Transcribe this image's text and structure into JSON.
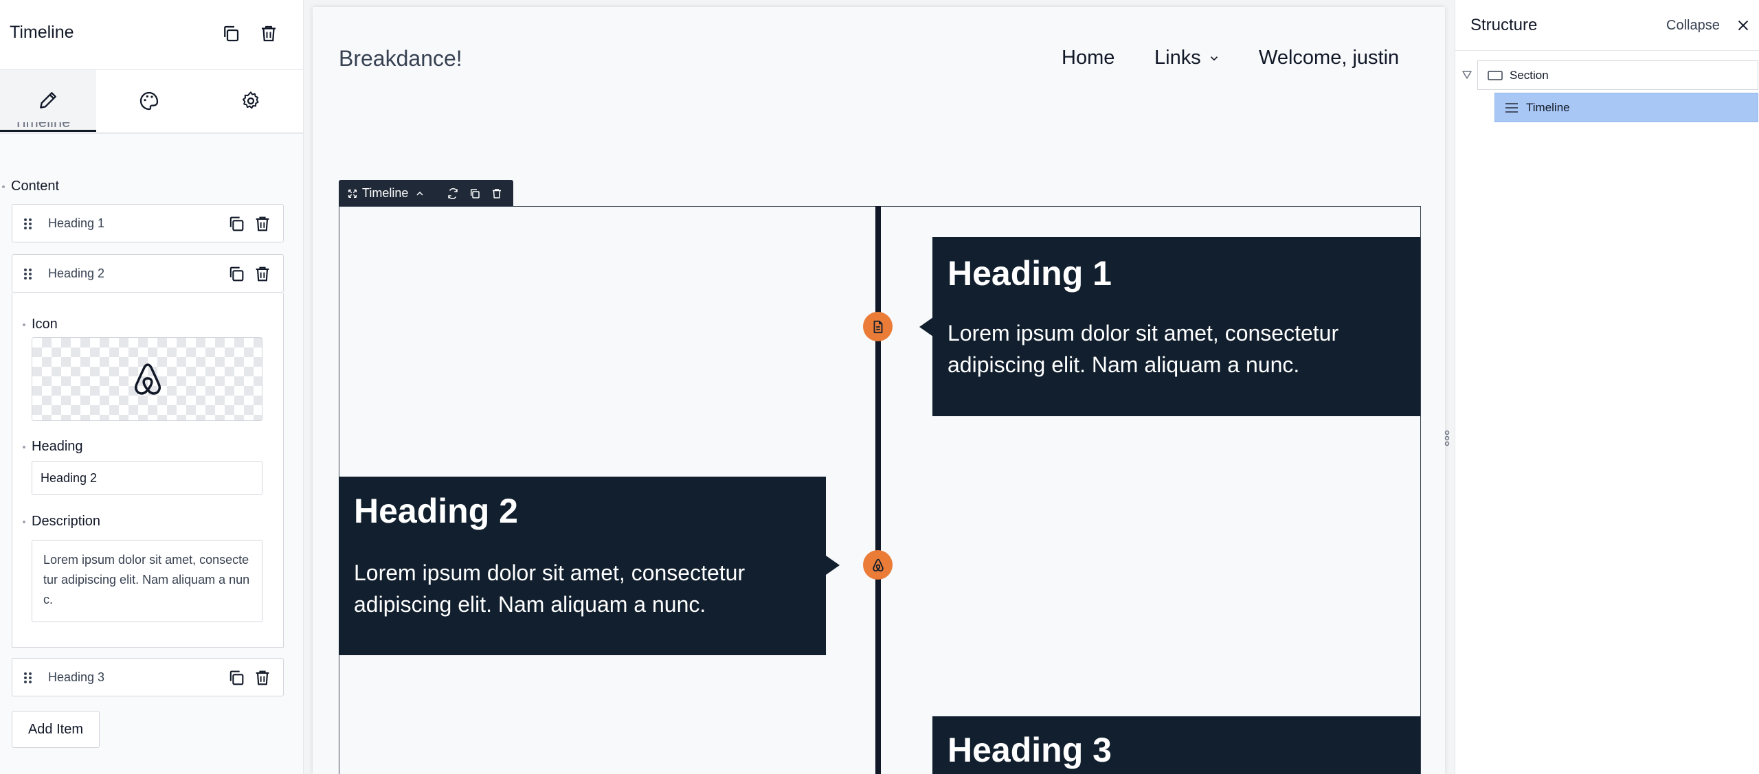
{
  "left_panel": {
    "title": "Timeline",
    "tabs": [
      {
        "name": "content",
        "icon": "pencil-icon",
        "active": true
      },
      {
        "name": "design",
        "icon": "palette-icon",
        "active": false
      },
      {
        "name": "settings",
        "icon": "gear-icon",
        "active": false
      }
    ],
    "cut_off_label": "Timeline",
    "content_label": "Content",
    "items": [
      {
        "label": "Heading 1"
      },
      {
        "label": "Heading 2"
      },
      {
        "label": "Heading 3"
      }
    ],
    "icon_label": "Icon",
    "selected_icon": "airbnb-icon",
    "heading_label": "Heading",
    "heading_value": "Heading 2",
    "description_label": "Description",
    "description_value": "Lorem ipsum dolor sit amet, consectetur adipiscing elit. Nam aliquam a nunc.",
    "add_item_label": "Add Item"
  },
  "canvas": {
    "site_title": "Breakdance!",
    "nav": {
      "home": "Home",
      "links": "Links",
      "welcome": "Welcome, justin"
    },
    "element_toolbar_label": "Timeline",
    "timeline_items": [
      {
        "heading": "Heading 1",
        "description": "Lorem ipsum dolor sit amet, consectetur adipiscing elit. Nam aliquam a nunc.",
        "icon": "document-icon"
      },
      {
        "heading": "Heading 2",
        "description": "Lorem ipsum dolor sit amet, consectetur adipiscing elit. Nam aliquam a nunc.",
        "icon": "airbnb-icon"
      },
      {
        "heading": "Heading 3"
      }
    ],
    "accent_color": "#ea7c37",
    "card_color": "#111f2e"
  },
  "right_panel": {
    "title": "Structure",
    "collapse_label": "Collapse",
    "tree": [
      {
        "label": "Section",
        "icon": "section-icon",
        "selected": false
      },
      {
        "label": "Timeline",
        "icon": "list-icon",
        "selected": true
      }
    ],
    "selected_color": "#a9c7f5"
  }
}
